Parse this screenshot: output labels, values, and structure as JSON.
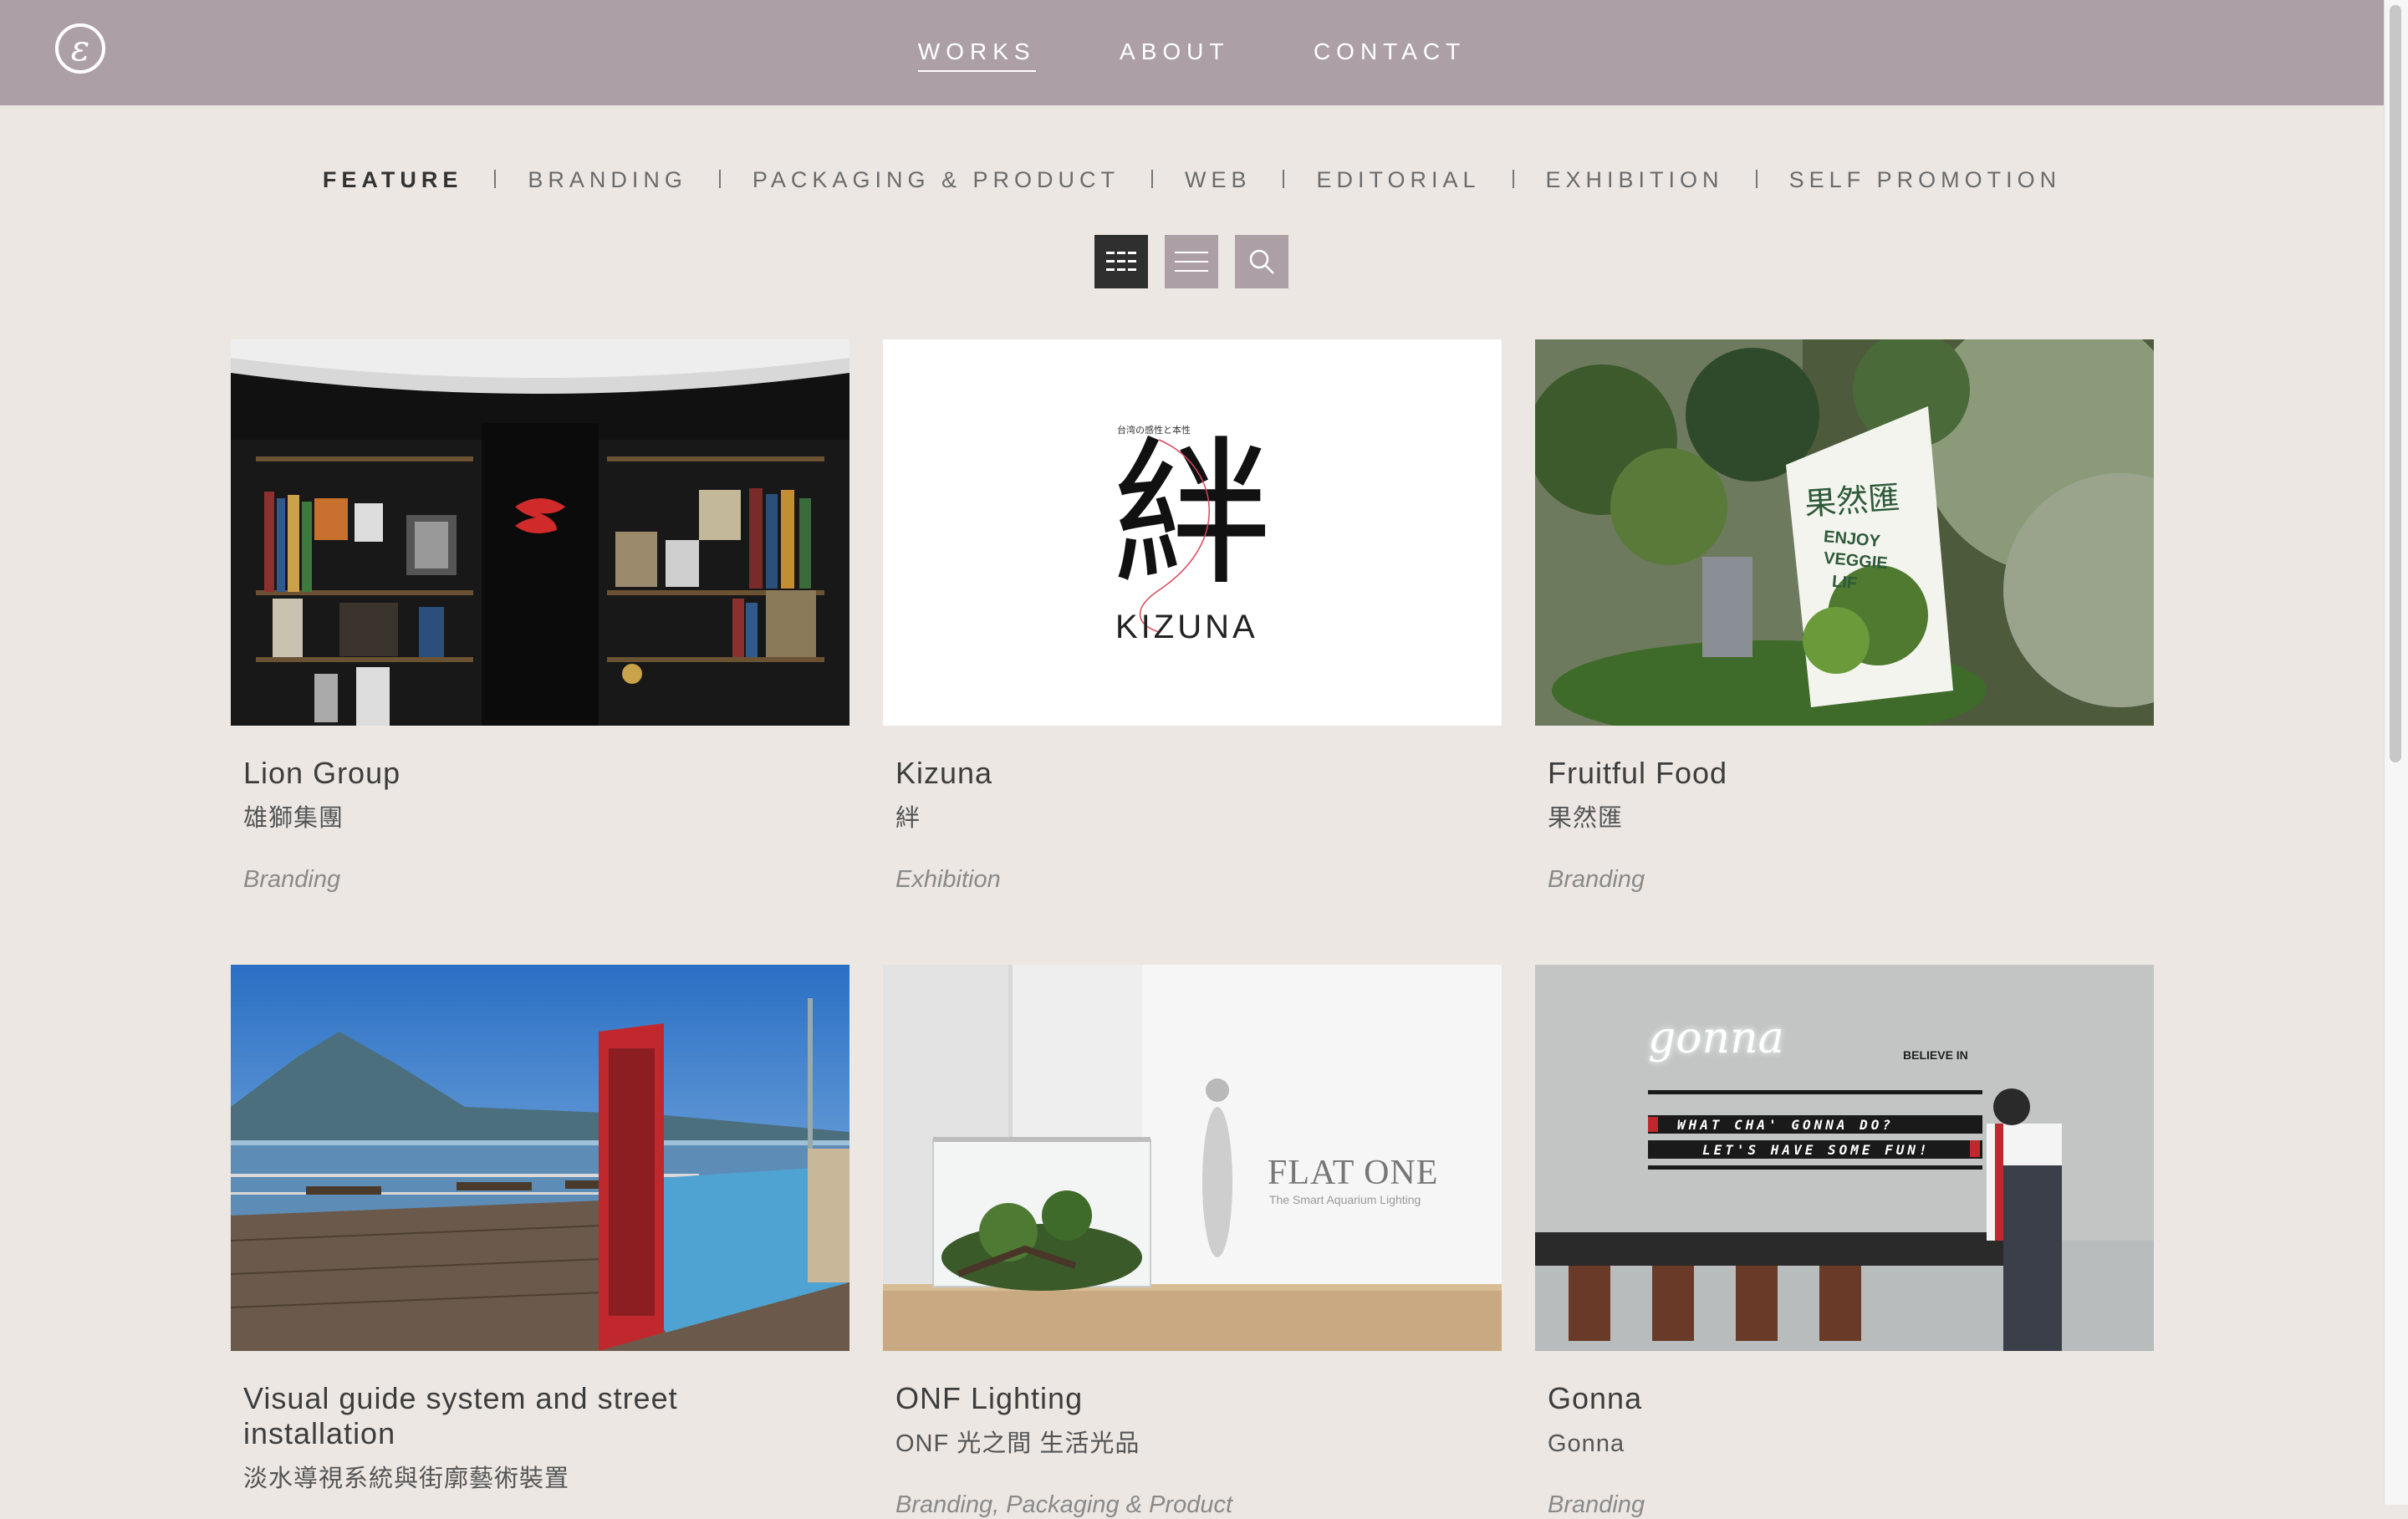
{
  "header": {
    "logo_glyph": "ε",
    "nav": [
      {
        "label": "WORKS",
        "active": true
      },
      {
        "label": "ABOUT",
        "active": false
      },
      {
        "label": "CONTACT",
        "active": false
      }
    ]
  },
  "categories": [
    {
      "label": "FEATURE",
      "active": true
    },
    {
      "label": "BRANDING",
      "active": false
    },
    {
      "label": "PACKAGING & PRODUCT",
      "active": false
    },
    {
      "label": "WEB",
      "active": false
    },
    {
      "label": "EDITORIAL",
      "active": false
    },
    {
      "label": "EXHIBITION",
      "active": false
    },
    {
      "label": "SELF PROMOTION",
      "active": false
    }
  ],
  "view_controls": {
    "grid_icon": "grid-icon",
    "list_icon": "list-icon",
    "search_icon": "search-icon"
  },
  "works": [
    {
      "title": "Lion Group",
      "subtitle": "雄獅集團",
      "category": "Branding"
    },
    {
      "title": "Kizuna",
      "subtitle": "絆",
      "category": "Exhibition",
      "image_text": {
        "small": "台湾の感性と本性",
        "kanji": "絆",
        "word": "KIZUNA"
      }
    },
    {
      "title": "Fruitful Food",
      "subtitle": "果然匯",
      "category": "Branding",
      "image_text": {
        "sign_cn": "果然匯",
        "sign_en": [
          "ENJOY",
          "VEGGIE",
          "LIF"
        ]
      }
    },
    {
      "title": "Visual guide system and street installation",
      "subtitle": "淡水導視系統與街廓藝術裝置",
      "category": ""
    },
    {
      "title": "ONF Lighting",
      "subtitle": "ONF 光之間 生活光品",
      "category": "Branding, Packaging & Product",
      "image_text": {
        "brand": "FLAT ONE",
        "tagline": "The Smart Aquarium Lighting"
      }
    },
    {
      "title": "Gonna",
      "subtitle": "Gonna",
      "category": "Branding",
      "image_text": {
        "neon": "gonna",
        "believe": "BELIEVE IN",
        "line1": "WHAT CHA' GONNA DO?",
        "line2": "LET'S HAVE SOME FUN!"
      }
    }
  ],
  "colors": {
    "header": "#aca0a6",
    "background": "#ece7e3",
    "active_button": "#2f2f2f"
  }
}
